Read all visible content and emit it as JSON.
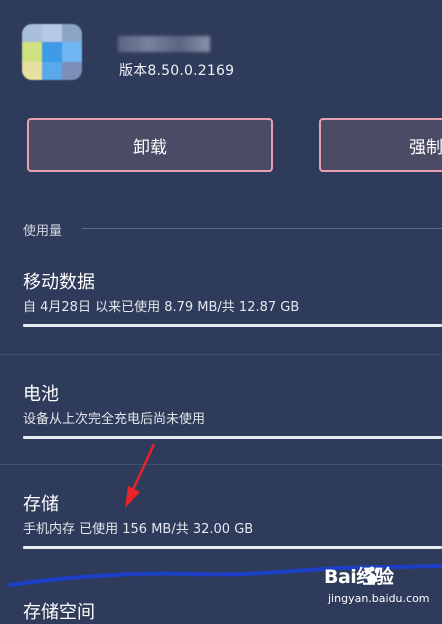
{
  "app": {
    "version": "版本8.50.0.2169"
  },
  "buttons": {
    "uninstall": "卸载",
    "force_stop": "强制"
  },
  "usage_section": {
    "label": "使用量",
    "items": [
      {
        "title": "移动数据",
        "subtitle": "自 4月28日 以来已使用 8.79 MB/共 12.87 GB"
      },
      {
        "title": "电池",
        "subtitle": "设备从上次完全充电后尚未使用"
      },
      {
        "title": "存储",
        "subtitle": "手机内存 已使用 156 MB/共 32.00 GB"
      },
      {
        "title": "存储空间",
        "subtitle": ""
      }
    ]
  },
  "watermark": {
    "logo": "Bai经验",
    "url": "jingyan.baidu.com"
  },
  "colors": {
    "background": "#2f3b5a",
    "button_fill": "#4b4b66",
    "button_border": "#e7a0b2",
    "annotation_red": "#e8232a",
    "annotation_blue": "#1c3fc8"
  }
}
